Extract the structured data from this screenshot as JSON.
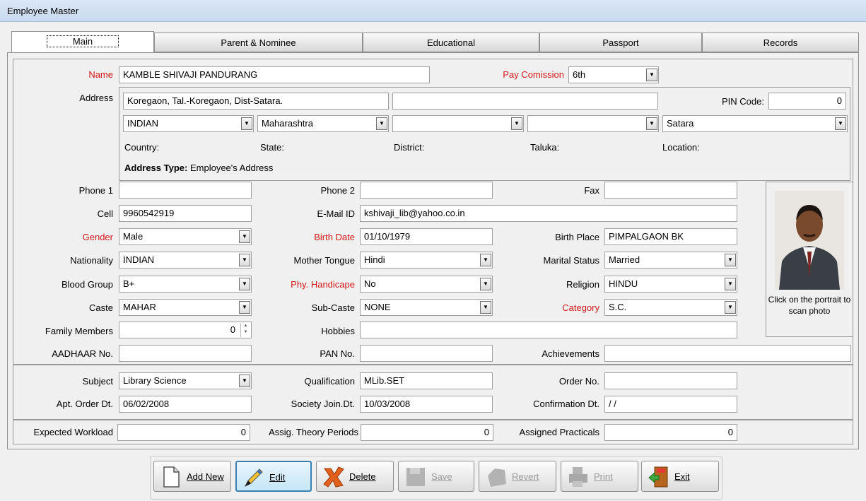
{
  "window": {
    "title": "Employee Master"
  },
  "tabs": [
    "Main",
    "Parent & Nominee",
    "Educational",
    "Passport",
    "Records"
  ],
  "form": {
    "name_label": "Name",
    "name": "KAMBLE SHIVAJI PANDURANG",
    "pay_label": "Pay Comission",
    "pay": "6th",
    "address_label": "Address",
    "address1": "Koregaon, Tal.-Koregaon, Dist-Satara.",
    "address2": "",
    "pin_label": "PIN Code:",
    "pin": "0",
    "country": "INDIAN",
    "state": "Maharashtra",
    "district": "",
    "taluka": "",
    "location": "Satara",
    "country_label": "Country:",
    "state_label": "State:",
    "district_label": "District:",
    "taluka_label": "Taluka:",
    "location_label": "Location:",
    "addr_type_label": "Address Type:",
    "addr_type": "Employee's Address",
    "phone1_label": "Phone 1",
    "phone1": "",
    "phone2_label": "Phone 2",
    "phone2": "",
    "fax_label": "Fax",
    "fax": "",
    "cell_label": "Cell",
    "cell": "9960542919",
    "email_label": "E-Mail ID",
    "email": "kshivaji_lib@yahoo.co.in",
    "gender_label": "Gender",
    "gender": "Male",
    "birthdate_label": "Birth Date",
    "birthdate": "01/10/1979",
    "birthplace_label": "Birth Place",
    "birthplace": "PIMPALGAON BK",
    "nationality_label": "Nationality",
    "nationality": "INDIAN",
    "mothertongue_label": "Mother Tongue",
    "mothertongue": "Hindi",
    "marital_label": "Marital Status",
    "marital": "Married",
    "blood_label": "Blood Group",
    "blood": "B+",
    "handicap_label": "Phy. Handicape",
    "handicap": "No",
    "religion_label": "Religion",
    "religion": "HINDU",
    "caste_label": "Caste",
    "caste": "MAHAR",
    "subcaste_label": "Sub-Caste",
    "subcaste": "NONE",
    "category_label": "Category",
    "category": "S.C.",
    "family_label": "Family Members",
    "family": "0",
    "hobbies_label": "Hobbies",
    "hobbies": "",
    "aadhaar_label": "AADHAAR No.",
    "aadhaar": "",
    "pan_label": "PAN No.",
    "pan": "",
    "achievements_label": "Achievements",
    "achievements": "",
    "photo_hint": "Click on the portrait to scan photo",
    "subject_label": "Subject",
    "subject": "Library Science",
    "qualification_label": "Qualification",
    "qualification": "MLib.SET",
    "order_label": "Order No.",
    "order": "",
    "aptorder_label": "Apt. Order Dt.",
    "aptorder": "06/02/2008",
    "society_label": "Society Join.Dt.",
    "society": "10/03/2008",
    "confirm_label": "Confirmation Dt.",
    "confirm": " / /",
    "workload_label": "Expected Workload",
    "workload": "0",
    "theory_label": "Assig. Theory Periods",
    "theory": "0",
    "practicals_label": "Assigned Practicals",
    "practicals": "0"
  },
  "buttons": {
    "add": "Add New",
    "edit": "Edit",
    "delete": "Delete",
    "save": "Save",
    "revert": "Revert",
    "print": "Print",
    "exit": "Exit"
  }
}
